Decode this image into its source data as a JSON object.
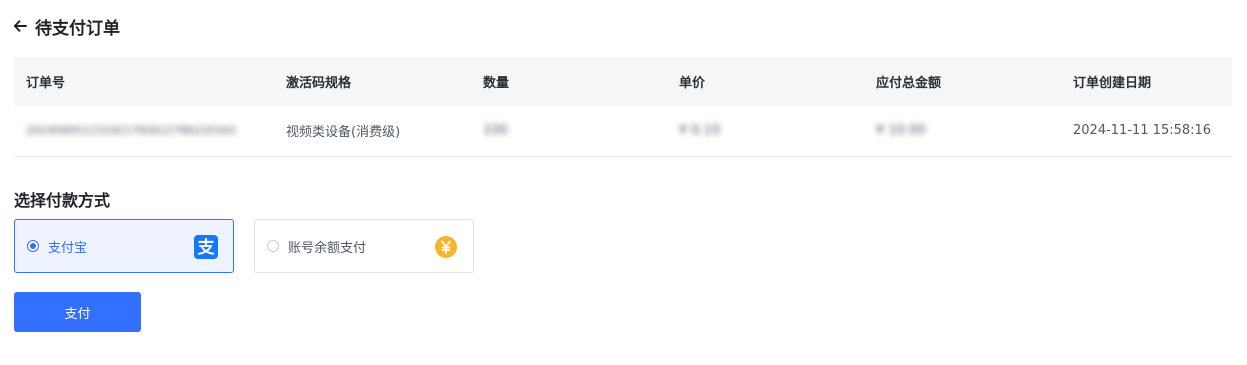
{
  "header": {
    "back_icon": "arrow-left-icon",
    "title": "待支付订单"
  },
  "order_table": {
    "columns": [
      "订单号",
      "激活码规格",
      "数量",
      "单价",
      "应付总金额",
      "订单创建日期"
    ],
    "rows": [
      [
        "202409051231921792612786220343",
        "视频类设备(消费级)",
        "100",
        "¥ 0.10",
        "¥ 10.00",
        "2024-11-11 15:58:16"
      ]
    ]
  },
  "payment": {
    "section_title": "选择付款方式",
    "methods": [
      {
        "label": "支付宝",
        "selected": true,
        "icon": "alipay-icon"
      },
      {
        "label": "账号余额支付",
        "selected": false,
        "icon": "yuan-coin-icon"
      }
    ],
    "pay_button": "支付"
  },
  "colors": {
    "primary": "#3370ff",
    "alipay": "#1677ff",
    "coin": "#f7b52c",
    "selected_bg": "#eef3ff",
    "table_header_bg": "#f5f6f8"
  }
}
